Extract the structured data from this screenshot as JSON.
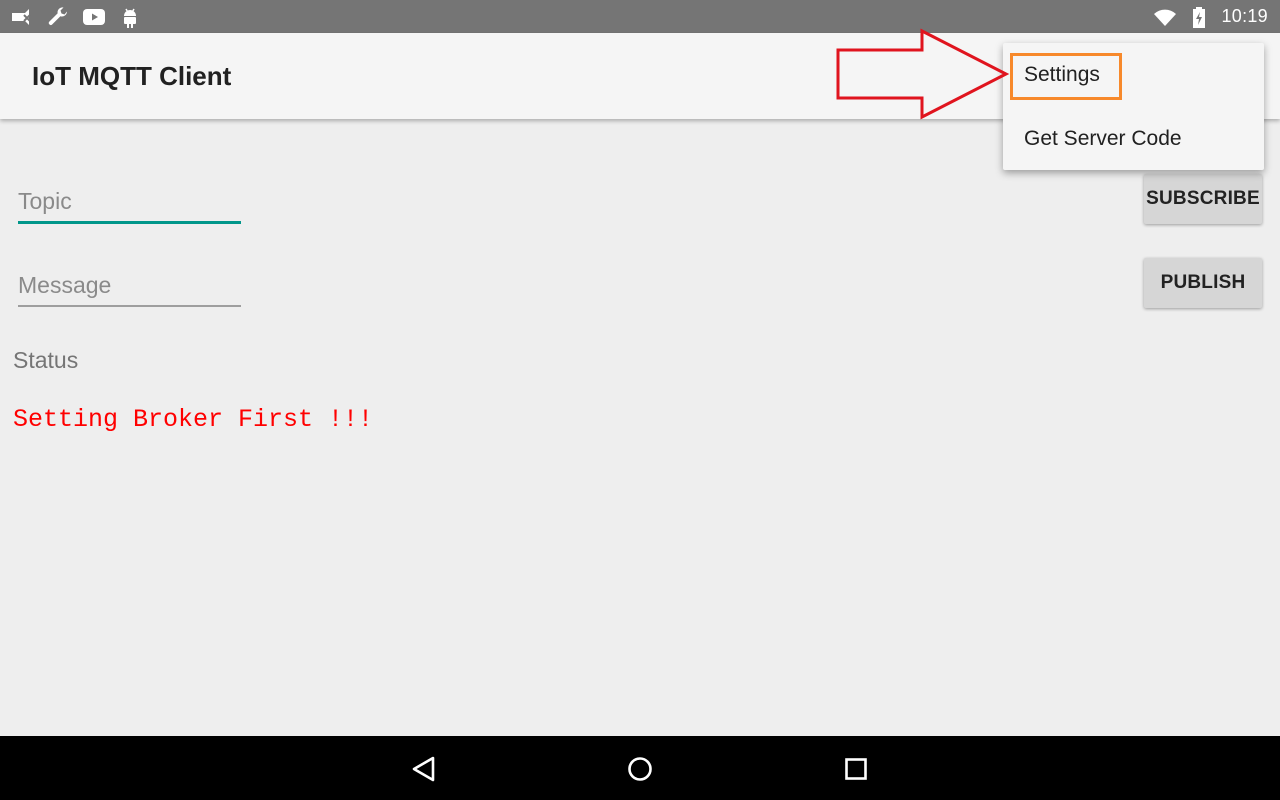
{
  "status_bar": {
    "time": "10:19",
    "left_icons": [
      "no-sim-icon",
      "wrench-icon",
      "youtube-icon",
      "android-icon"
    ],
    "right_icons": [
      "wifi-icon",
      "battery-icon"
    ]
  },
  "app_bar": {
    "title": "IoT MQTT Client"
  },
  "form": {
    "topic": {
      "value": "",
      "placeholder": "Topic"
    },
    "message": {
      "value": "",
      "placeholder": "Message"
    },
    "subscribe_label": "SUBSCRIBE",
    "publish_label": "PUBLISH"
  },
  "status": {
    "label": "Status",
    "message": "Setting Broker First !!!"
  },
  "overflow_menu": {
    "items": [
      {
        "label": "Settings"
      },
      {
        "label": "Get Server Code"
      }
    ]
  },
  "nav_bar": {
    "icons": [
      "back-icon",
      "home-icon",
      "recents-icon"
    ]
  },
  "colors": {
    "status_bar": "#757575",
    "app_bar": "#f5f5f5",
    "background": "#eeeeee",
    "accent_teal": "#00968a",
    "status_message_red": "#ff0000",
    "highlight_orange": "#f7892b",
    "annotation_arrow_red": "#e0141e"
  }
}
